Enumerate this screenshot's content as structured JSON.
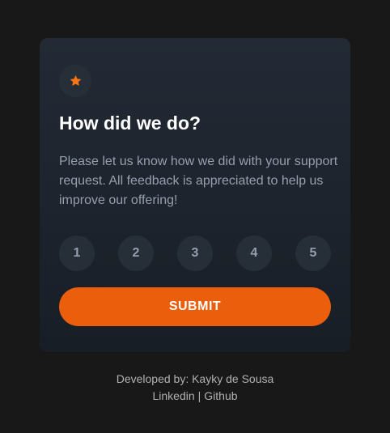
{
  "card": {
    "title": "How did we do?",
    "description": "Please let us know how we did with your support request. All feedback is appreciated to help us improve our offering!",
    "icon": "star-icon",
    "ratings": [
      "1",
      "2",
      "3",
      "4",
      "5"
    ],
    "submit_label": "SUBMIT"
  },
  "footer": {
    "developed_by": "Developed by: Kayky de Sousa",
    "linkedin_label": "Linkedin",
    "separator": "|",
    "github_label": "Github"
  },
  "colors": {
    "background": "#181818",
    "accent": "#ea5e0c",
    "star": "#fb7413",
    "muted_text": "#969fad"
  }
}
